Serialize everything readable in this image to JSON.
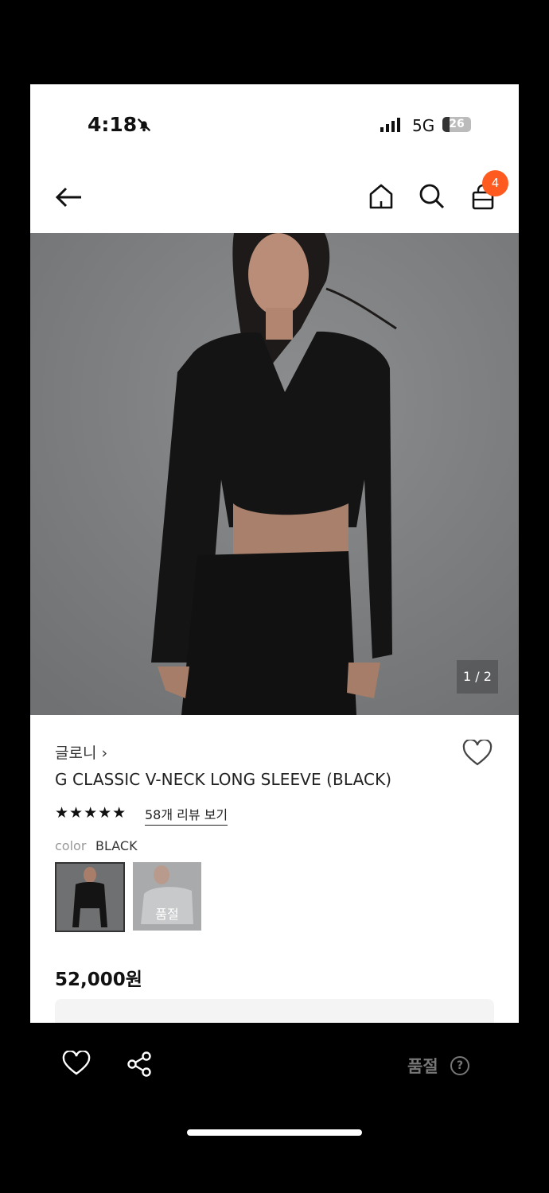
{
  "status_bar": {
    "time": "4:18",
    "network": "5G",
    "battery": "26",
    "battery_level": 0.26
  },
  "nav": {
    "cart_count": "4"
  },
  "gallery": {
    "pager": "1 / 2"
  },
  "product": {
    "brand": "글로니 ›",
    "title": "G CLASSIC V-NECK LONG SLEEVE (BLACK)",
    "rating_stars": "★★★★★",
    "rating": 5,
    "reviews_link": "58개 리뷰 보기",
    "color_label": "color",
    "color_value": "BLACK",
    "swatches": [
      {
        "name": "BLACK",
        "sold_out": false
      },
      {
        "name": "",
        "sold_out": true,
        "sold_out_label": "품절"
      }
    ],
    "price": "52,000원"
  },
  "bottom_bar": {
    "status": "품절",
    "help_icon": "?"
  },
  "colors": {
    "accent": "#ff5a1f",
    "hero_bg": "#7d7f81"
  }
}
